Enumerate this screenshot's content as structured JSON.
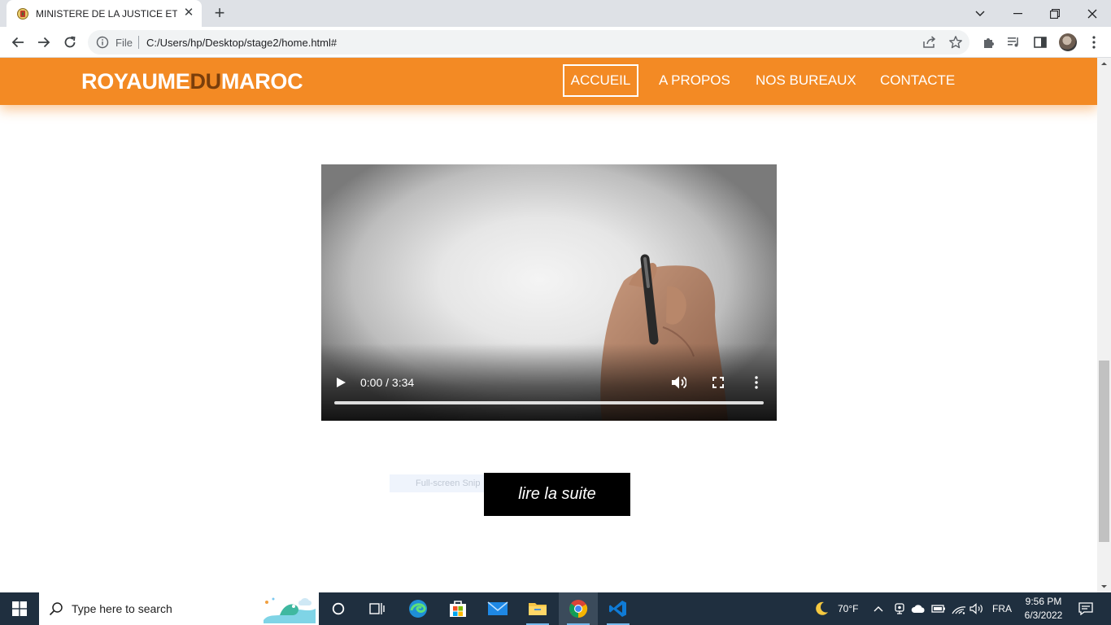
{
  "browser": {
    "tab_title": "MINISTERE DE LA JUSTICE ET DE",
    "address_scheme": "File",
    "address_url": "C:/Users/hp/Desktop/stage2/home.html#"
  },
  "site": {
    "logo": {
      "part1": "ROYAUME",
      "part2": "DU",
      "part3": "MAROC"
    },
    "nav": [
      "ACCUEIL",
      "A PROPOS",
      "NOS BUREAUX",
      "CONTACTE"
    ],
    "video": {
      "timecode": "0:00 / 3:34",
      "progress": 0
    },
    "snip_ghost_text": "Full-screen Snip",
    "read_more": "lire la suite"
  },
  "taskbar": {
    "search_placeholder": "Type here to search",
    "weather": "70°F",
    "language": "FRA",
    "time": "9:56 PM",
    "date": "6/3/2022"
  },
  "colors": {
    "header": "#f38a24",
    "logo_accent": "#7a3e0b",
    "button": "#000000"
  }
}
